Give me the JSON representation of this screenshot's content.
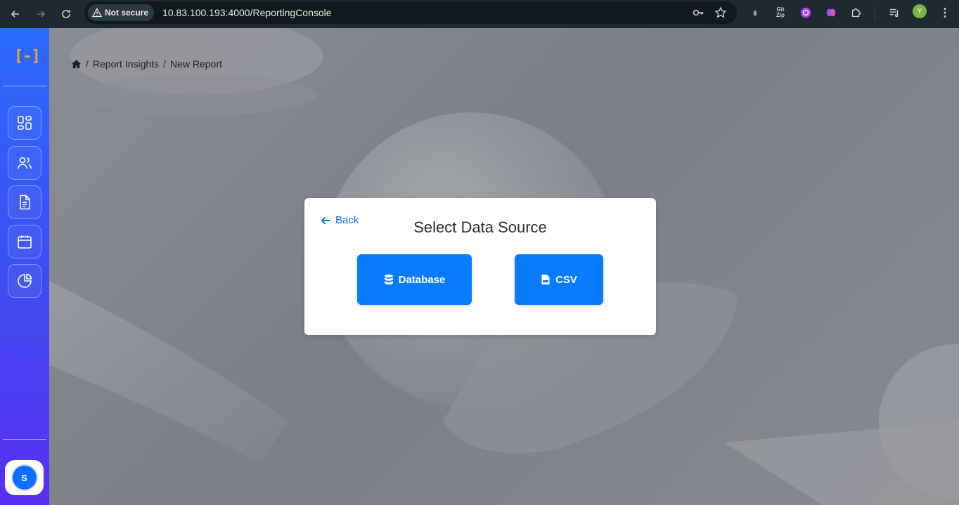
{
  "browser": {
    "security_label": "Not secure",
    "url": "10.83.100.193:4000/ReportingConsole",
    "profile_initial": "Y",
    "extension_label": "Git Zip"
  },
  "sidebar": {
    "logo": "[-]",
    "items": [
      {
        "icon": "dashboard-grid-icon"
      },
      {
        "icon": "users-icon"
      },
      {
        "icon": "document-icon"
      },
      {
        "icon": "calendar-icon"
      },
      {
        "icon": "pie-chart-icon"
      }
    ],
    "user_initial": "S"
  },
  "breadcrumb": {
    "home_icon": "home-icon",
    "items": [
      "Report Insights",
      "New Report"
    ],
    "separator": "/"
  },
  "modal": {
    "back_label": "Back",
    "title": "Select Data Source",
    "options": [
      {
        "label": "Database",
        "icon": "database-icon"
      },
      {
        "label": "CSV",
        "icon": "csv-file-icon"
      }
    ]
  },
  "colors": {
    "accent": "#0a7bff",
    "sidebar_top": "#2a6bff",
    "sidebar_bottom": "#5a2ef2",
    "logo": "#f0a52a"
  }
}
